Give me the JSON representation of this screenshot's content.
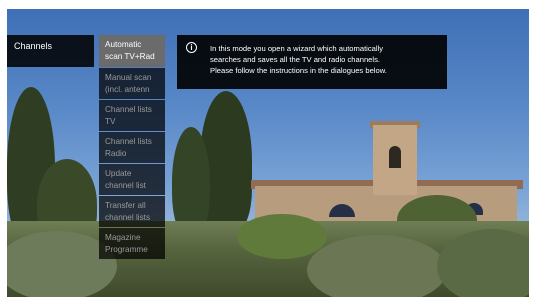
{
  "sidebar": {
    "title": "Channels"
  },
  "submenu": {
    "items": [
      {
        "lines": [
          "Automatic",
          "scan TV+Rad"
        ],
        "state": "selected"
      },
      {
        "lines": [
          "Manual scan",
          "(incl. antenn"
        ],
        "state": "normal"
      },
      {
        "lines": [
          "Channel lists",
          "TV"
        ],
        "state": "normal"
      },
      {
        "lines": [
          "Channel lists",
          "Radio"
        ],
        "state": "normal"
      },
      {
        "lines": [
          "Update",
          "channel list"
        ],
        "state": "normal"
      },
      {
        "lines": [
          "Transfer all",
          "channel lists"
        ],
        "state": "normal"
      },
      {
        "lines": [
          "Magazine",
          "Programme"
        ],
        "state": "normal"
      }
    ]
  },
  "info": {
    "icon": "info-icon",
    "lines": [
      "In this mode you open a wizard which automatically",
      "searches and saves all the TV and radio channels.",
      "Please follow the instructions in the dialogues below."
    ]
  },
  "colors": {
    "panel_bg": "#000000",
    "selected_bg": "#6b6b6b",
    "text_active": "#ffffff",
    "text_inactive": "#9a9a9a"
  }
}
